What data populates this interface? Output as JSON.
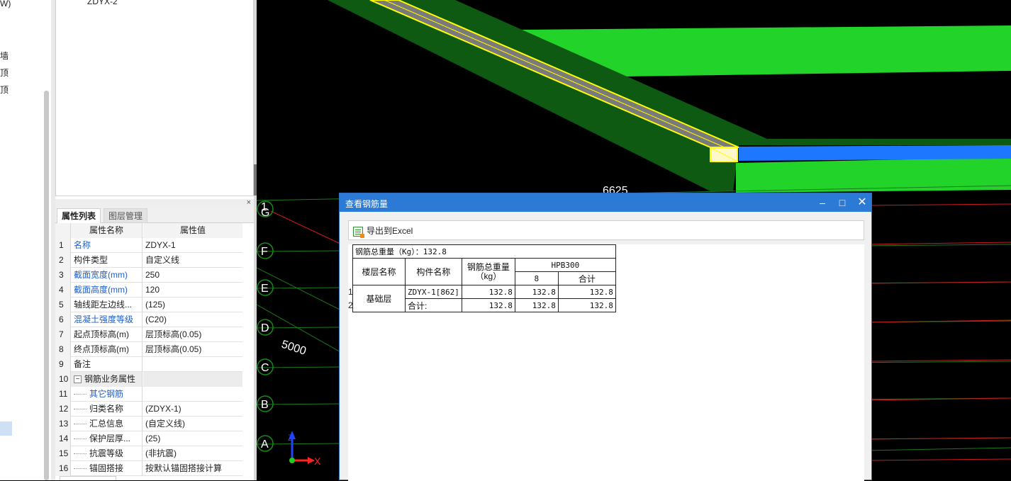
{
  "left_strip": {
    "fragments": [
      "W)",
      "墙",
      "顶",
      "顶"
    ]
  },
  "tree": {
    "item": "ZDYX-2"
  },
  "properties_panel": {
    "close_glyph": "×",
    "tabs": [
      {
        "label": "属性列表",
        "active": true
      },
      {
        "label": "图层管理",
        "active": false
      }
    ],
    "headers": {
      "name": "属性名称",
      "value": "属性值"
    },
    "rows": [
      {
        "num": "1",
        "name": "名称",
        "value": "ZDYX-1",
        "blue": true
      },
      {
        "num": "2",
        "name": "构件类型",
        "value": "自定义线",
        "blue": false
      },
      {
        "num": "3",
        "name": "截面宽度(mm)",
        "value": "250",
        "blue": true
      },
      {
        "num": "4",
        "name": "截面高度(mm)",
        "value": "120",
        "blue": true
      },
      {
        "num": "5",
        "name": "轴线距左边线...",
        "value": "(125)",
        "blue": false
      },
      {
        "num": "6",
        "name": "混凝土强度等级",
        "value": "(C20)",
        "blue": true
      },
      {
        "num": "7",
        "name": "起点顶标高(m)",
        "value": "层顶标高(0.05)",
        "blue": false
      },
      {
        "num": "8",
        "name": "终点顶标高(m)",
        "value": "层顶标高(0.05)",
        "blue": false
      },
      {
        "num": "9",
        "name": "备注",
        "value": "",
        "blue": false
      },
      {
        "num": "10",
        "name": "钢筋业务属性",
        "value": "",
        "blue": false,
        "group": true
      },
      {
        "num": "11",
        "name": "其它钢筋",
        "value": "",
        "blue": true,
        "child": true
      },
      {
        "num": "12",
        "name": "归类名称",
        "value": "(ZDYX-1)",
        "blue": false,
        "child": true
      },
      {
        "num": "13",
        "name": "汇总信息",
        "value": "(自定义线)",
        "blue": false,
        "child": true
      },
      {
        "num": "14",
        "name": "保护层厚...",
        "value": "(25)",
        "blue": false,
        "child": true
      },
      {
        "num": "15",
        "name": "抗震等级",
        "value": "(非抗震)",
        "blue": false,
        "child": true
      },
      {
        "num": "16",
        "name": "锚固搭接",
        "value": "按默认锚固搭接计算",
        "blue": false,
        "child": true
      }
    ]
  },
  "viewport": {
    "dimension_top": "6625",
    "dimension_left": "5000",
    "axis_labels": [
      "1",
      "G",
      "F",
      "E",
      "D",
      "C",
      "B",
      "A"
    ],
    "gizmo": {
      "z": "Z",
      "x": "X"
    },
    "colors": {
      "green": "#22d42a",
      "dark_green": "#0f5a12",
      "blue": "#1e78ff",
      "gray": "#7a7a7a",
      "yellow": "#ffff00",
      "red": "#cc1a1a"
    }
  },
  "dialog": {
    "title": "查看钢筋量",
    "minimize": "–",
    "maximize": "□",
    "close": "✕",
    "export_label": "导出到Excel",
    "row_numbers": [
      "1",
      "2"
    ],
    "table": {
      "total_line": "钢筋总重量（Kg）：132.8",
      "col_floor": "楼层名称",
      "col_component": "构件名称",
      "col_weight": "钢筋总重量（kg）",
      "col_grade": "HPB300",
      "sub_8": "8",
      "sub_total": "合计",
      "floor": "基础层",
      "rows": [
        {
          "component": "ZDYX-1[862]",
          "weight": "132.8",
          "d8": "132.8",
          "total": "132.8"
        },
        {
          "component": "合计:",
          "weight": "132.8",
          "d8": "132.8",
          "total": "132.8"
        }
      ]
    }
  }
}
